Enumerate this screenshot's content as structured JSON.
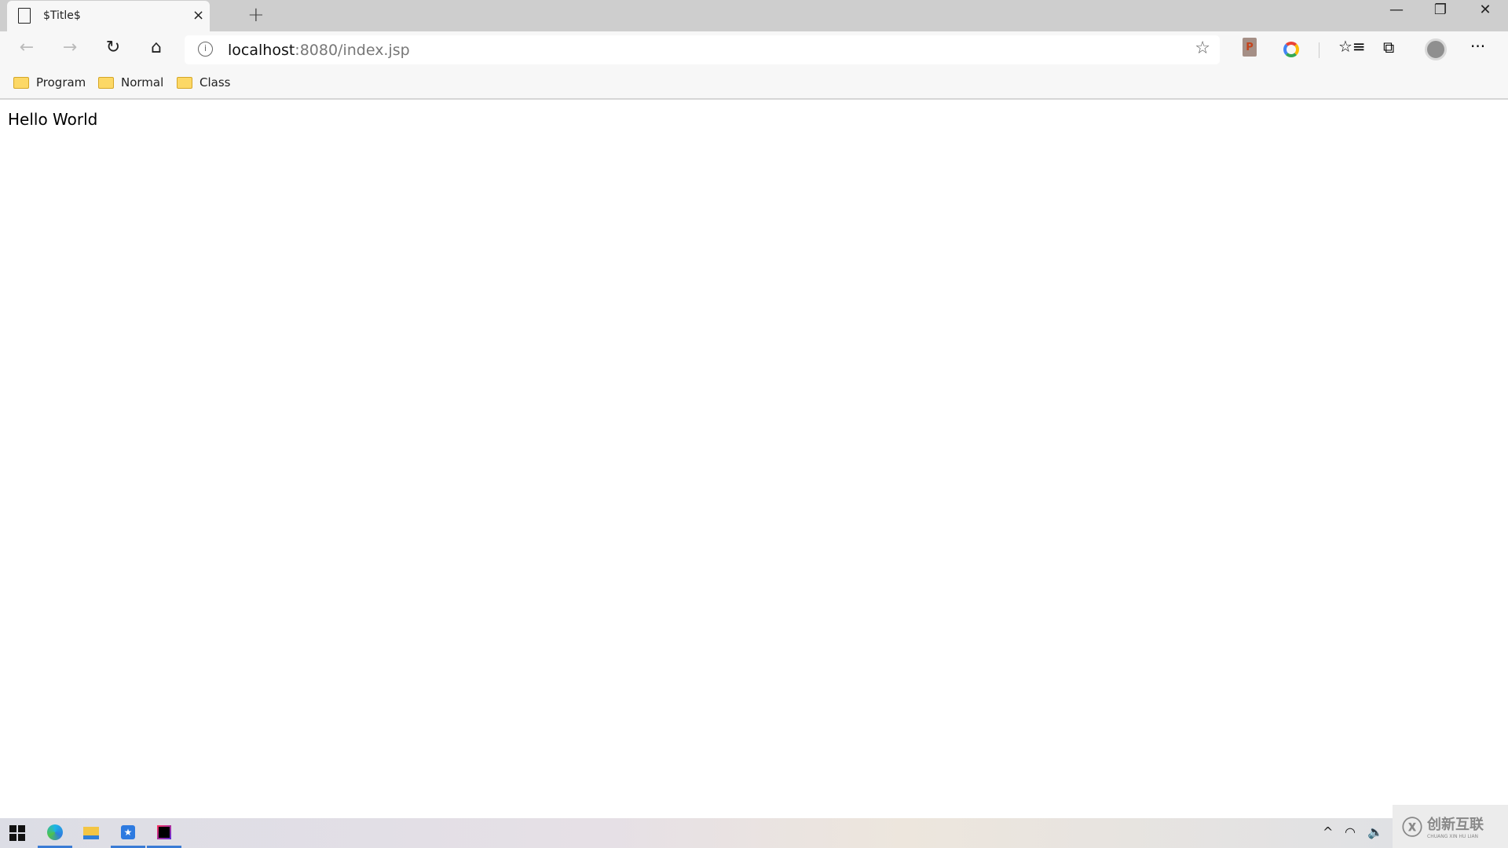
{
  "tab": {
    "title": "$Title$",
    "close": "×",
    "new_tab": "+"
  },
  "window": {
    "minimize": "—",
    "restore": "❐",
    "close": "✕"
  },
  "toolbar": {
    "back": "←",
    "forward": "→",
    "refresh": "↻",
    "home": "⌂",
    "url_host": "localhost",
    "url_rest": ":8080/index.jsp",
    "favorite": "☆",
    "more": "···"
  },
  "extensions": {
    "ppt_label": "P"
  },
  "bookmarks": [
    {
      "label": "Program"
    },
    {
      "label": "Normal"
    },
    {
      "label": "Class"
    }
  ],
  "page": {
    "text": "Hello World"
  },
  "watermark": {
    "text": "创新互联",
    "sub": "CHUANG XIN HU LIAN"
  },
  "colors": {
    "accent": "#3a7bd5",
    "tabbar": "#cecece",
    "toolbar": "#f7f7f7"
  }
}
